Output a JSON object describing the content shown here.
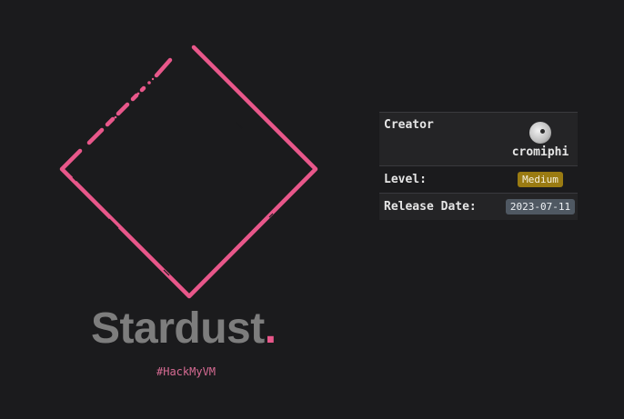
{
  "machine": {
    "name": "Stardust",
    "name_suffix": ".",
    "platform_tag": "#HackMyVM"
  },
  "info": {
    "creator_label": "Creator",
    "creator_name": "cromiphi",
    "level_label": "Level:",
    "level_value": "Medium",
    "release_label": "Release Date:",
    "release_value": "2023-07-11"
  },
  "colors": {
    "background": "#1b1b1d",
    "accent_pink": "#e8578a",
    "level_badge": "#9a7b12",
    "date_badge": "#4f5862",
    "title_gray": "#7d7d7d"
  },
  "icons": {
    "logo": "diamond-outline-icon",
    "avatar": "creator-avatar"
  }
}
